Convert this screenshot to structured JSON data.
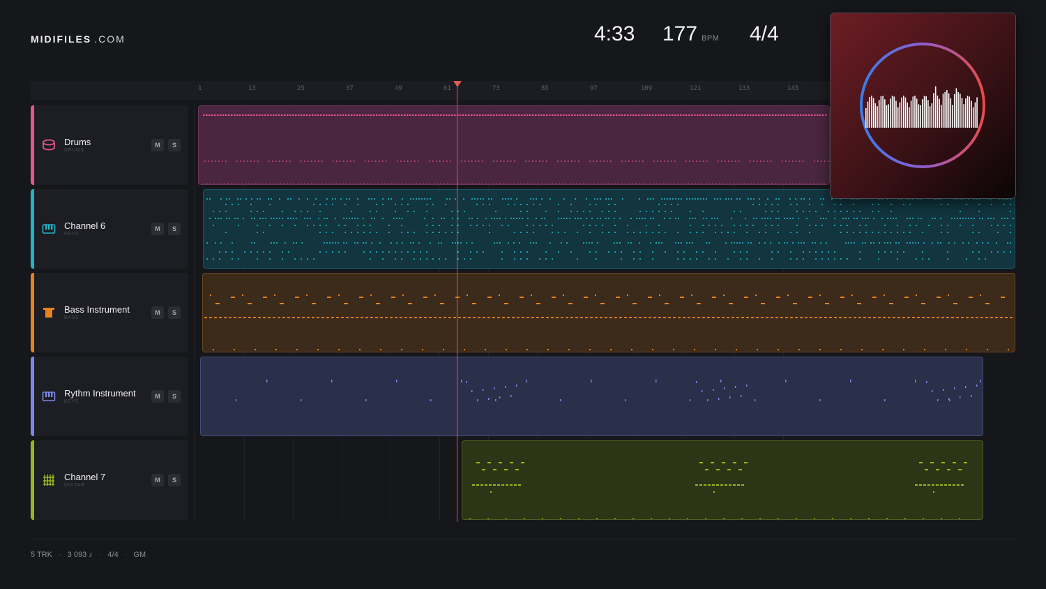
{
  "header": {
    "logo_main": "MIDIFILES",
    "logo_domain": ".COM",
    "duration": "4:33",
    "tempo": "177",
    "tempo_unit": "BPM",
    "time_signature": "4/4"
  },
  "ruler": {
    "ticks": [
      "1",
      "13",
      "25",
      "37",
      "49",
      "61",
      "73",
      "85",
      "97",
      "109",
      "121",
      "133",
      "145"
    ]
  },
  "playhead_bar": 62,
  "tracks": [
    {
      "name": "Drums",
      "type": "DRUMS",
      "color": "#e8558e",
      "icon": "drum-icon",
      "mute": "M",
      "solo": "S"
    },
    {
      "name": "Channel 6",
      "type": "KEYS",
      "color": "#1fb3c9",
      "icon": "piano-keys-icon",
      "mute": "M",
      "solo": "S"
    },
    {
      "name": "Bass Instrument",
      "type": "BASS",
      "color": "#e8821e",
      "icon": "bass-amp-icon",
      "mute": "M",
      "solo": "S"
    },
    {
      "name": "Rythm Instrument",
      "type": "KEYS",
      "color": "#7b87e8",
      "icon": "piano-keys-icon",
      "mute": "M",
      "solo": "S"
    },
    {
      "name": "Channel 7",
      "type": "GUITAR",
      "color": "#9bb51e",
      "icon": "guitar-fretboard-icon",
      "mute": "M",
      "solo": "S"
    }
  ],
  "footer": {
    "tracks": "5 TRK",
    "notes": "3 093 ♪",
    "time_signature": "4/4",
    "standard": "GM"
  },
  "colors": {
    "background": "#16171b",
    "playhead": "#e05a4c",
    "art_ring_start": "#3b7be8",
    "art_ring_end": "#e84a4a"
  }
}
